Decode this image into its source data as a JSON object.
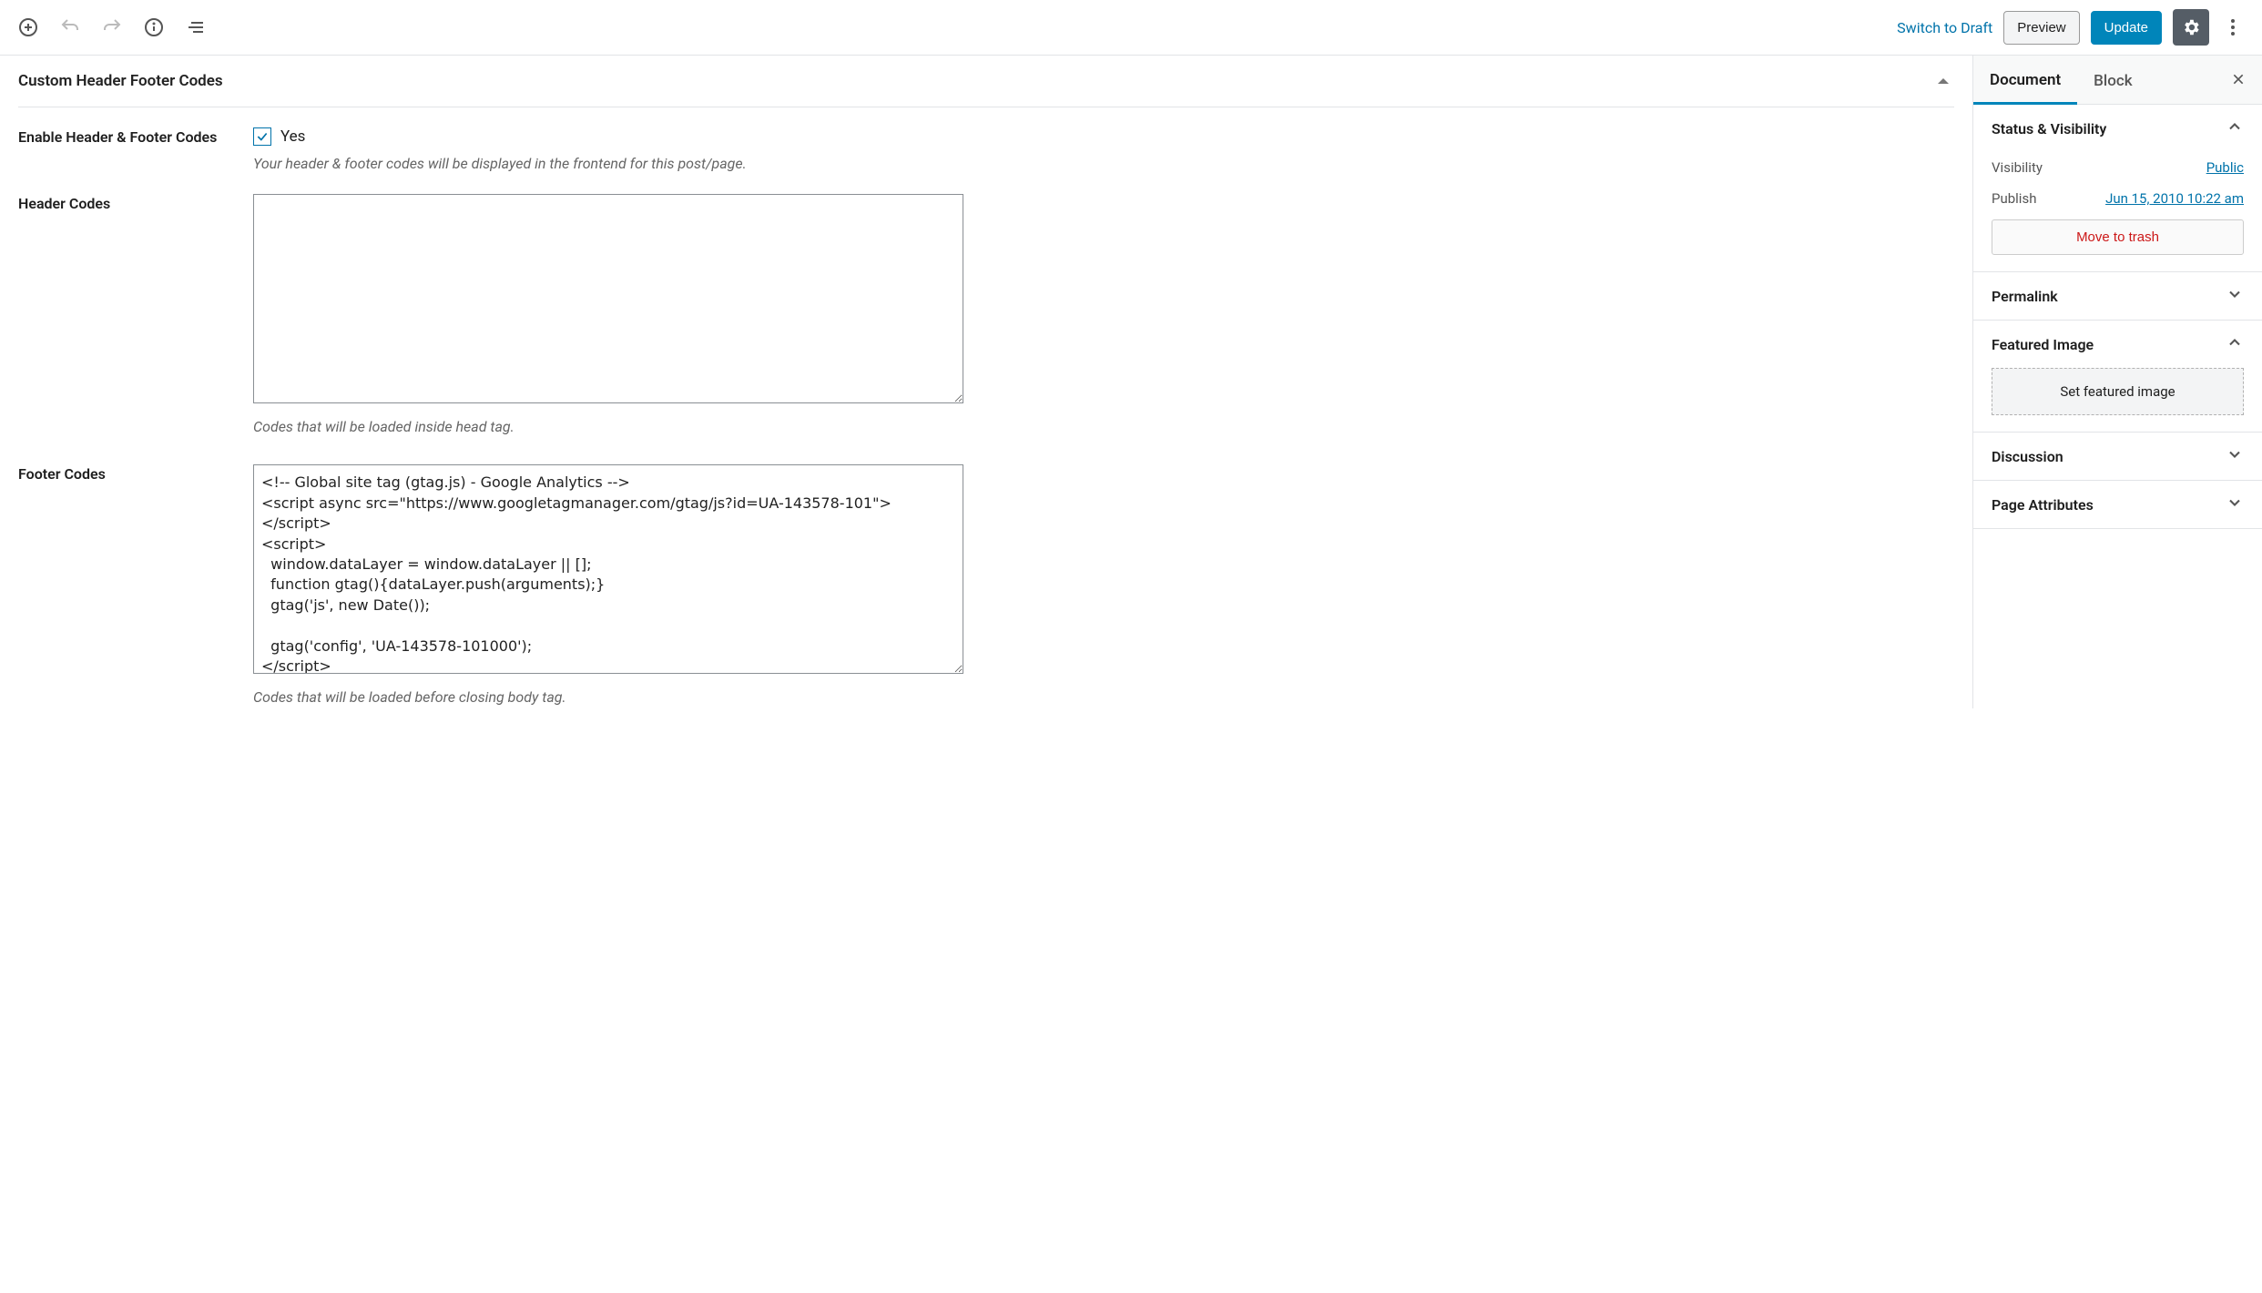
{
  "topbar": {
    "switch_draft": "Switch to Draft",
    "preview": "Preview",
    "update": "Update"
  },
  "panel": {
    "title": "Custom Header Footer Codes",
    "enable_label": "Enable Header & Footer Codes",
    "enable_option": "Yes",
    "enable_hint": "Your header & footer codes will be displayed in the frontend for this post/page.",
    "header_label": "Header Codes",
    "header_value": "",
    "header_hint": "Codes that will be loaded inside head tag.",
    "footer_label": "Footer Codes",
    "footer_value": "<!-- Global site tag (gtag.js) - Google Analytics -->\n<script async src=\"https://www.googletagmanager.com/gtag/js?id=UA-143578-101\"></script>\n<script>\n  window.dataLayer = window.dataLayer || [];\n  function gtag(){dataLayer.push(arguments);}\n  gtag('js', new Date());\n\n  gtag('config', 'UA-143578-101000');\n</script>",
    "footer_hint": "Codes that will be loaded before closing body tag."
  },
  "sidebar": {
    "tabs": {
      "document": "Document",
      "block": "Block"
    },
    "status": {
      "title": "Status & Visibility",
      "visibility_k": "Visibility",
      "visibility_v": "Public",
      "publish_k": "Publish",
      "publish_v": "Jun 15, 2010 10:22 am",
      "trash": "Move to trash"
    },
    "permalink": "Permalink",
    "featured": {
      "title": "Featured Image",
      "button": "Set featured image"
    },
    "discussion": "Discussion",
    "page_attr": "Page Attributes"
  }
}
